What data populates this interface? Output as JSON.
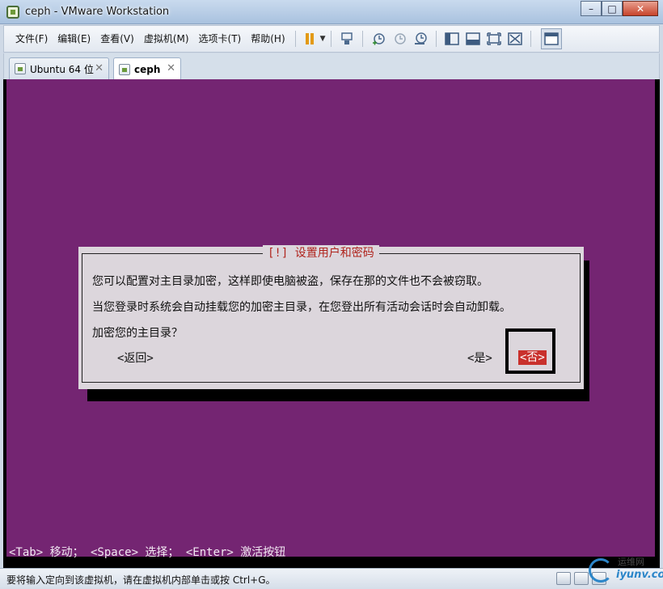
{
  "window": {
    "title": "ceph - VMware Workstation",
    "minimize_glyph": "–",
    "maximize_glyph": "□",
    "close_glyph": "✕"
  },
  "menu": [
    {
      "label": "文件(F)"
    },
    {
      "label": "编辑(E)"
    },
    {
      "label": "查看(V)"
    },
    {
      "label": "虚拟机(M)"
    },
    {
      "label": "选项卡(T)"
    },
    {
      "label": "帮助(H)"
    }
  ],
  "toolbar": {
    "icons": [
      "pause-icon",
      "send-ctrl-alt-del-icon",
      "snapshot-take-icon",
      "snapshot-revert-icon",
      "snapshot-manager-icon",
      "sidebar-icon",
      "console-view-icon",
      "fullscreen-icon",
      "unity-icon",
      "thumbnail-icon"
    ]
  },
  "tabs": [
    {
      "label": "Ubuntu 64 位",
      "active": false
    },
    {
      "label": "ceph",
      "active": true
    }
  ],
  "dialog": {
    "title": "[!] 设置用户和密码",
    "line1": "您可以配置对主目录加密，这样即使电脑被盗，保存在那的文件也不会被窃取。",
    "line2": "当您登录时系统会自动挂载您的加密主目录，在您登出所有活动会话时会自动卸载。",
    "question": "加密您的主目录？",
    "back_button": "<返回>",
    "yes_button": "<是>",
    "no_button": "<否>"
  },
  "vm_hint": "<Tab> 移动； <Space> 选择； <Enter> 激活按钮",
  "statusbar": {
    "text": "要将输入定向到该虚拟机，请在虚拟机内部单击或按 Ctrl+G。"
  },
  "watermark": {
    "top": "运维网",
    "bottom": "iyunv.com"
  },
  "colors": {
    "vm_background": "#742572",
    "dialog_background": "#dcd6dc",
    "dialog_title": "#b0251e",
    "selected_button": "#c9302c"
  }
}
